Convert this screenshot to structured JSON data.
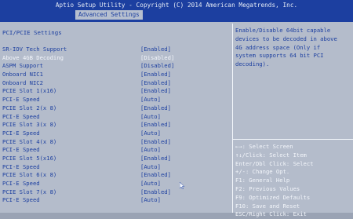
{
  "header": {
    "title": "Aptio Setup Utility - Copyright (C) 2014 American Megatrends, Inc.",
    "active_tab": "Advanced Settings"
  },
  "section_title": "PCI/PCIE Settings",
  "menu": [
    {
      "label": "SR-IOV Tech Support",
      "value": "[Enabled]"
    },
    {
      "label": "Above 4GB Decoding",
      "value": "[Disabled]",
      "highlighted": true
    },
    {
      "label": "ASPM Support",
      "value": "[Disabled]"
    },
    {
      "label": "Onboard NIC1",
      "value": "[Enabled]"
    },
    {
      "label": "Onboard NIC2",
      "value": "[Enabled]"
    },
    {
      "label": "PCIE Slot  1(x16)",
      "value": "[Enabled]"
    },
    {
      "label": "PCI-E Speed",
      "value": "[Auto]"
    },
    {
      "label": "PCIE Slot  2(x 8)",
      "value": "[Enabled]"
    },
    {
      "label": "PCI-E Speed",
      "value": "[Auto]"
    },
    {
      "label": "PCIE Slot  3(x 8)",
      "value": "[Enabled]"
    },
    {
      "label": "PCI-E Speed",
      "value": "[Auto]"
    },
    {
      "label": "PCIE Slot  4(x 8)",
      "value": "[Enabled]"
    },
    {
      "label": "PCI-E Speed",
      "value": "[Auto]"
    },
    {
      "label": "PCIE Slot  5(x16)",
      "value": "[Enabled]"
    },
    {
      "label": "PCI-E Speed",
      "value": "[Auto]"
    },
    {
      "label": "PCIE Slot  6(x 8)",
      "value": "[Enabled]"
    },
    {
      "label": "PCI-E Speed",
      "value": "[Auto]"
    },
    {
      "label": "PCIE Slot  7(x 8)",
      "value": "[Enabled]"
    },
    {
      "label": "PCI-E Speed",
      "value": "[Auto]"
    }
  ],
  "help": [
    "Enable/Disable 64bit capable",
    "devices to be decoded in above",
    "4G address space (Only if",
    "system supports 64 bit PCI",
    "decoding)."
  ],
  "keys": [
    "←→: Select Screen",
    "↑↓/Click: Select Item",
    "Enter/Dbl Click: Select",
    "+/-: Change Opt.",
    "F1: General Help",
    "F2: Previous Values",
    "F9: Optimized Defaults",
    "F10: Save and Reset",
    "ESC/Right Click: Exit"
  ],
  "colors": {
    "header_bg": "#1c3fa0",
    "body_bg": "#b4bccb",
    "text": "#1c3fa0",
    "highlight_text": "#f3f6fb"
  },
  "icons": {
    "cursor": "mouse-pointer-icon"
  }
}
